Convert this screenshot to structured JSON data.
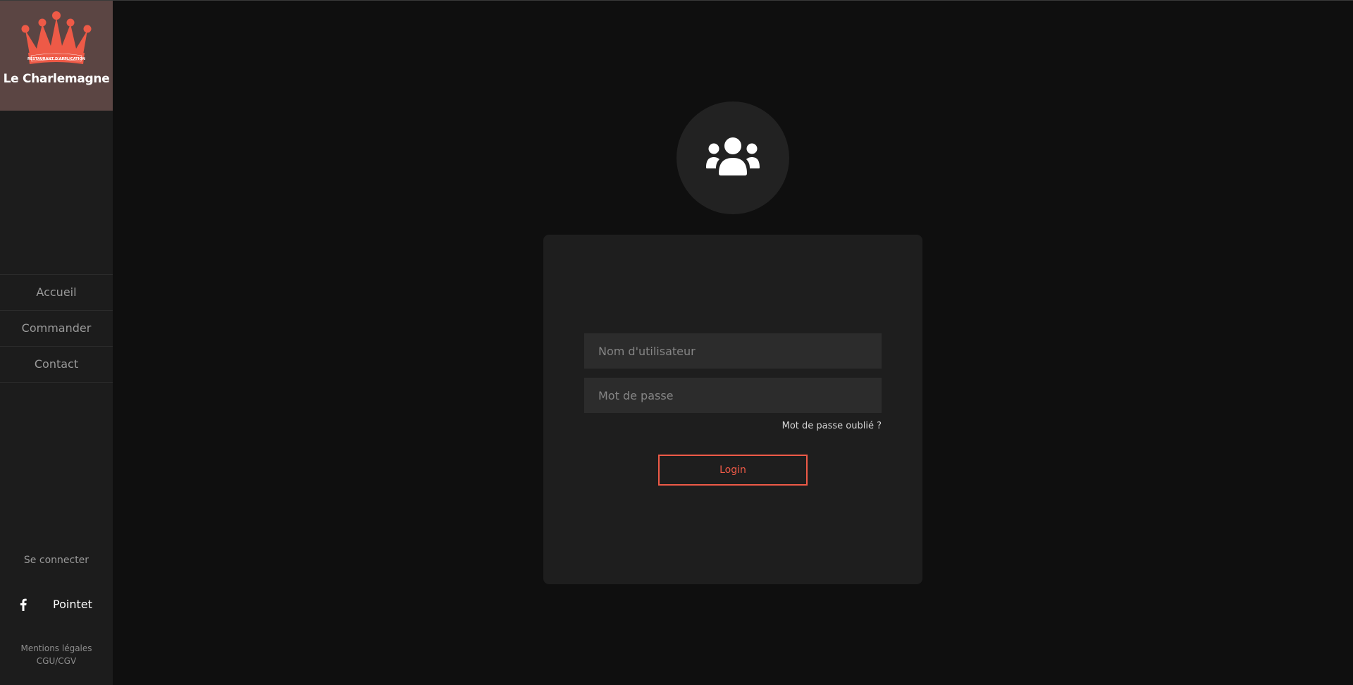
{
  "sidebar": {
    "logo": {
      "badge_text": "RESTAURANT D'APPLICATION",
      "brand_name": "Le Charlemagne"
    },
    "nav": [
      {
        "label": "Accueil"
      },
      {
        "label": "Commander"
      },
      {
        "label": "Contact"
      }
    ],
    "login_link": "Se connecter",
    "social": {
      "icon": "facebook-icon",
      "name": "Pointet"
    },
    "legal": {
      "mentions": "Mentions légales",
      "cgu": "CGU/CGV"
    }
  },
  "login": {
    "avatar_icon": "users-icon",
    "username_placeholder": "Nom d'utilisateur",
    "password_placeholder": "Mot de passe",
    "forgot_label": "Mot de passe oublié ?",
    "submit_label": "Login"
  },
  "colors": {
    "accent": "#ee5a47",
    "logo_background": "#5b4543",
    "sidebar_background": "#1c1c1c",
    "page_background": "#0f0f0f",
    "card_background": "#1e1e1e",
    "input_background": "#2c2c2c"
  }
}
